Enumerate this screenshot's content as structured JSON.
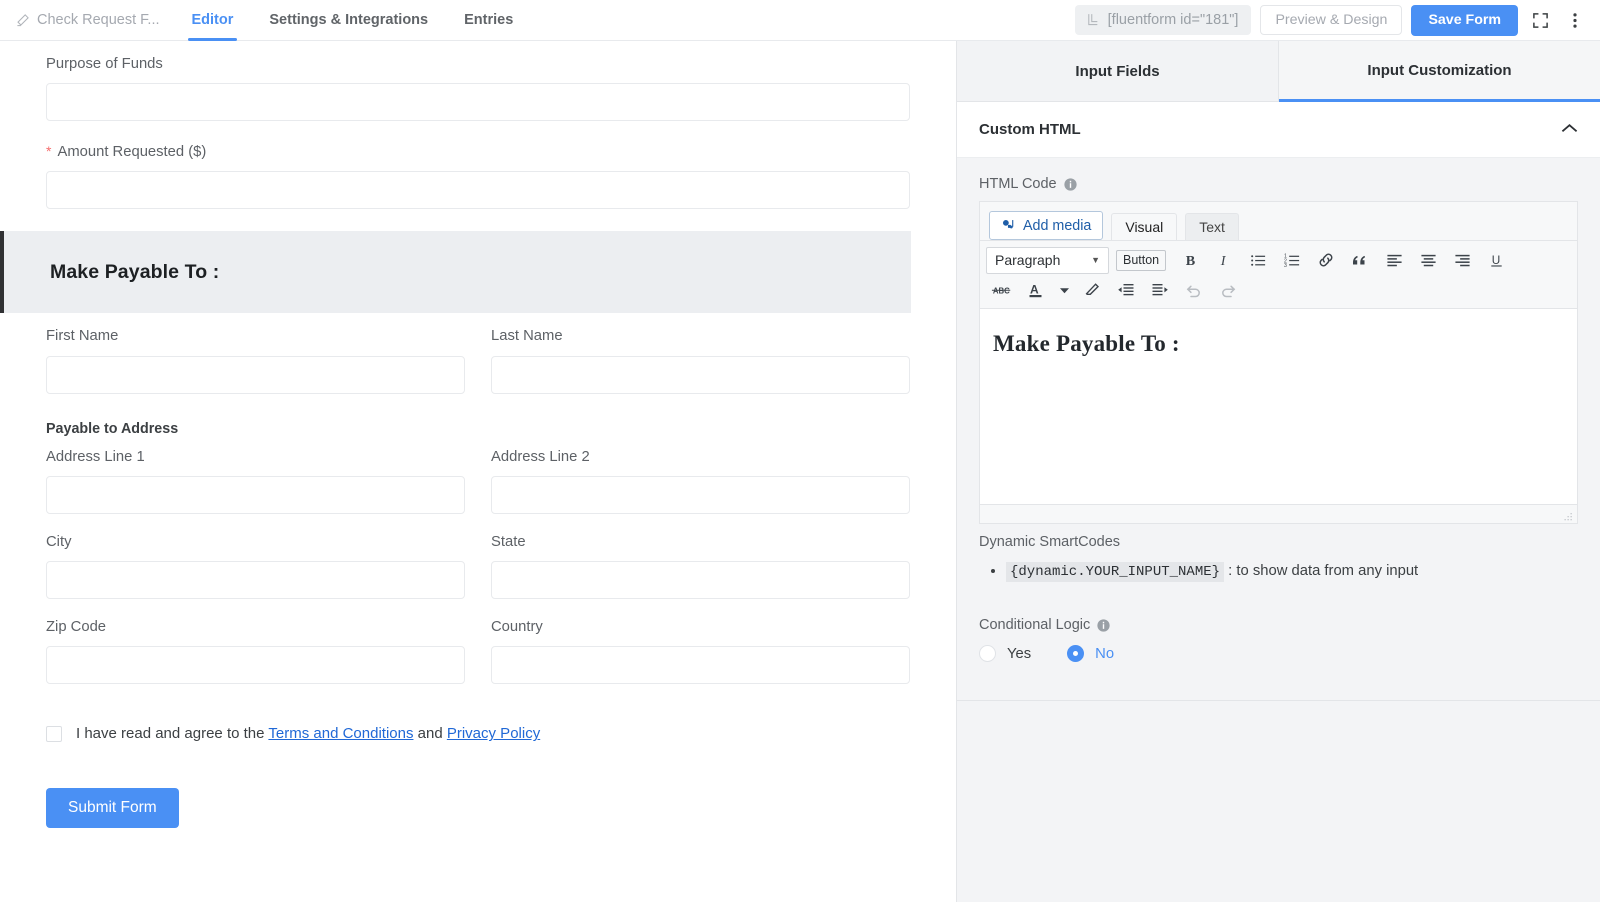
{
  "header": {
    "form_name": "Check Request F...",
    "pencil_icon": "pencil-icon",
    "tabs": [
      {
        "label": "Editor",
        "active": true
      },
      {
        "label": "Settings & Integrations",
        "active": false
      },
      {
        "label": "Entries",
        "active": false
      }
    ],
    "shortcode": "[fluentform id=\"181\"]",
    "copy_icon": "copy-shortcode-icon",
    "preview_label": "Preview & Design",
    "save_label": "Save Form",
    "fullscreen_icon": "fullscreen-icon",
    "more_icon": "more-vertical-icon",
    "accent_color": "#4a90f4"
  },
  "form": {
    "purpose_label": "Purpose of Funds",
    "amount_label": "Amount Requested ($)",
    "amount_required_mark": "*",
    "selected_block_heading": "Make Payable To :",
    "first_name_label": "First Name",
    "last_name_label": "Last Name",
    "payable_address_label": "Payable to Address",
    "address1_label": "Address Line 1",
    "address2_label": "Address Line 2",
    "city_label": "City",
    "state_label": "State",
    "zip_label": "Zip Code",
    "country_label": "Country",
    "terms_prefix": "I have read and agree to the",
    "terms_link": "Terms and Conditions",
    "terms_join": "and",
    "privacy_link": "Privacy Policy",
    "submit_label": "Submit Form"
  },
  "panel": {
    "tabs": [
      {
        "label": "Input Fields",
        "active": false
      },
      {
        "label": "Input Customization",
        "active": true
      }
    ],
    "section_title": "Custom HTML",
    "collapse_icon": "chevron-up-icon",
    "html_code_label": "HTML Code",
    "info_icon": "info-icon",
    "editor": {
      "add_media_label": "Add media",
      "add_media_icon": "add-media-icon",
      "visual_tab": "Visual",
      "text_tab": "Text",
      "format_select": "Paragraph",
      "button_chip": "Button",
      "toolbar_row1": [
        "bold-icon",
        "italic-icon",
        "bulleted-list-icon",
        "numbered-list-icon",
        "link-icon",
        "blockquote-icon",
        "align-left-icon",
        "align-center-icon",
        "align-right-icon",
        "underline-icon"
      ],
      "toolbar_row2": [
        "strikethrough-icon",
        "text-color-icon",
        "text-color-caret-icon",
        "clear-formatting-icon",
        "decrease-indent-icon",
        "increase-indent-icon",
        "undo-icon",
        "redo-icon"
      ],
      "content_heading": "Make Payable To :",
      "resize_handle_icon": "resize-handle-icon"
    },
    "smartcodes_title": "Dynamic SmartCodes",
    "smartcode_token": "{dynamic.YOUR_INPUT_NAME}",
    "smartcode_desc": ": to show data from any input",
    "conditional_logic_label": "Conditional Logic",
    "conditional_options": [
      {
        "label": "Yes",
        "selected": false
      },
      {
        "label": "No",
        "selected": true
      }
    ]
  }
}
